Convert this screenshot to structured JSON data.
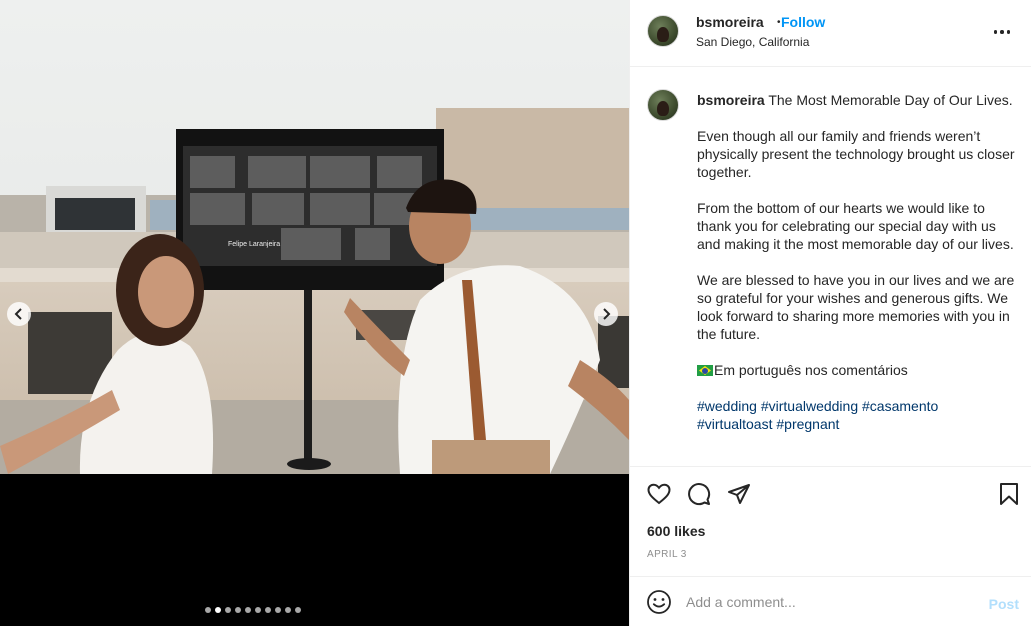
{
  "post": {
    "username": "bsmoreira",
    "follow_label": "Follow",
    "separator": "•",
    "location": "San Diego, California"
  },
  "media": {
    "description": "wedding-couple-with-video-call-screen",
    "screen_name_label": "Felipe Laranjeira",
    "slide_count": 10,
    "active_slide": 2
  },
  "caption": {
    "username": "bsmoreira",
    "headline": " The Most Memorable Day of Our Lives.",
    "paragraph1": "Even though all our family and friends weren’t physically present the technology brought us closer together.",
    "paragraph2": "From the bottom of our hearts we would like to thank you for celebrating our special day with us and making it the most memorable day of our lives.",
    "paragraph3": "We are blessed to have you in our lives and we are so grateful for your wishes and generous gifts. We look forward to sharing more memories with you in the future.",
    "portuguese_note": "Em português nos comentários",
    "hashtags": [
      "#wedding",
      "#virtualwedding",
      "#casamento",
      "#virtualtoast",
      "#pregnant"
    ]
  },
  "engagement": {
    "likes": "600 likes",
    "date": "APRIL 3"
  },
  "comment": {
    "placeholder": "Add a comment...",
    "post_label": "Post"
  },
  "colors": {
    "accent": "#0095f6",
    "hashtag": "#00376b",
    "muted": "#8e8e8e",
    "post_disabled": "#b2dffc"
  }
}
